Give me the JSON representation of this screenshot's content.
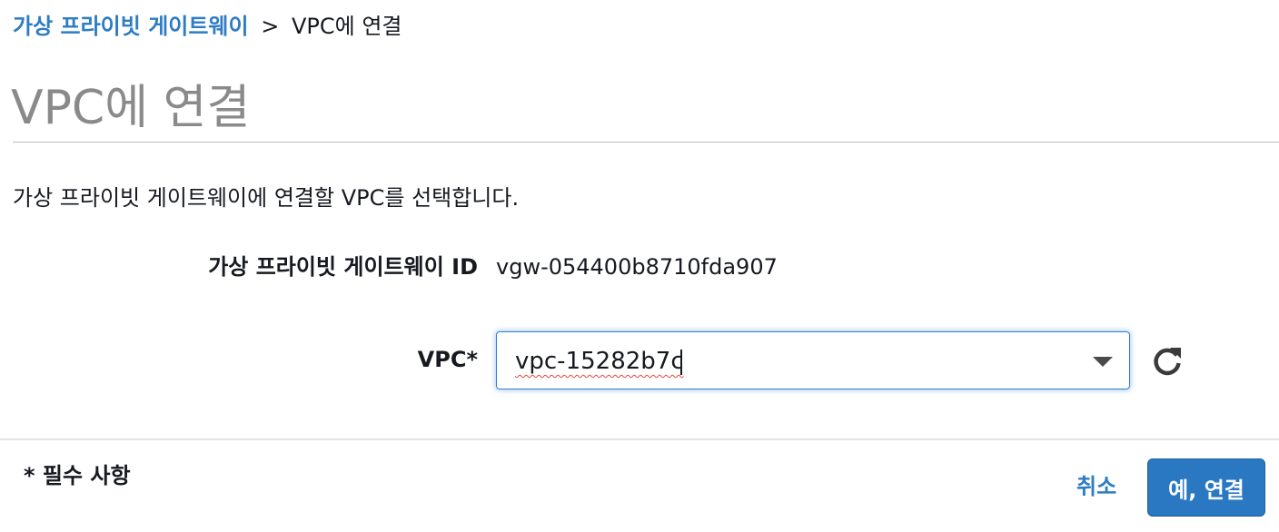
{
  "breadcrumb": {
    "parent": "가상 프라이빗 게이트웨이",
    "separator": ">",
    "current": "VPC에 연결"
  },
  "page_title": "VPC에 연결",
  "description": "가상 프라이빗 게이트웨이에 연결할 VPC를 선택합니다.",
  "fields": {
    "vgw_id": {
      "label": "가상 프라이빗 게이트웨이 ID",
      "value": "vgw-054400b8710fda907"
    },
    "vpc": {
      "label": "VPC*",
      "value": "vpc-15282b7c"
    }
  },
  "footer": {
    "required_note": "* 필수 사항",
    "cancel_label": "취소",
    "confirm_label": "예, 연결"
  },
  "colors": {
    "link": "#2d7cc4",
    "primary_button": "#2a78c2",
    "title": "#8a8a8a"
  },
  "icons": {
    "refresh": "refresh-icon",
    "dropdown": "chevron-down-icon"
  }
}
